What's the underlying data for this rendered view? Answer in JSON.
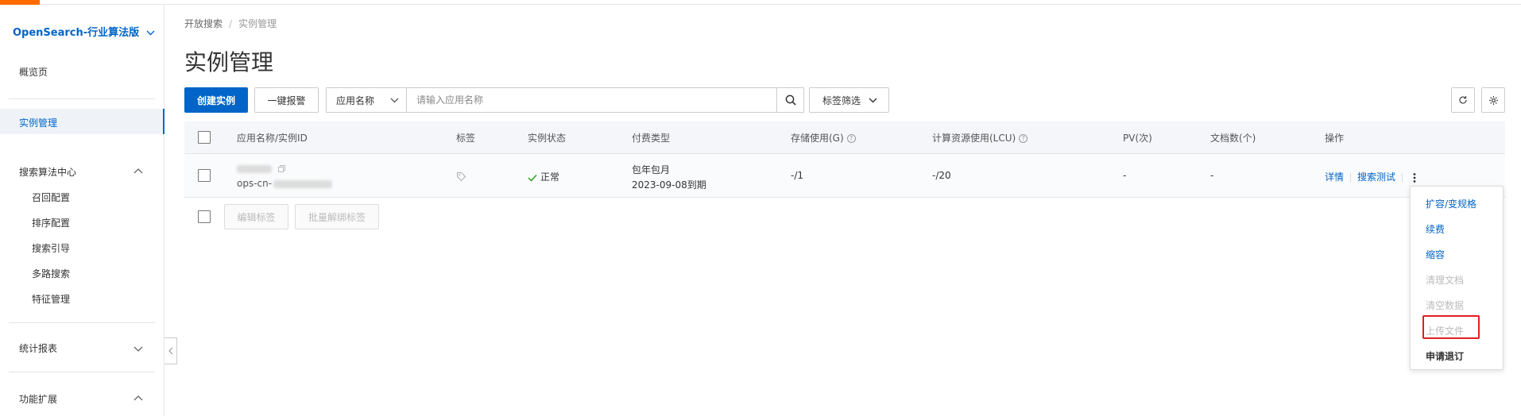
{
  "sidebar": {
    "product": "OpenSearch-行业算法版",
    "overview": "概览页",
    "instances": "实例管理",
    "search_center": "搜索算法中心",
    "search_center_items": [
      "召回配置",
      "排序配置",
      "搜索引导",
      "多路搜索",
      "特征管理"
    ],
    "stats": "统计报表",
    "extensions": "功能扩展"
  },
  "breadcrumb": {
    "root": "开放搜索",
    "current": "实例管理"
  },
  "page_title": "实例管理",
  "toolbar": {
    "create": "创建实例",
    "alarm": "一键报警",
    "search_field": "应用名称",
    "search_placeholder": "请输入应用名称",
    "tag_filter": "标签筛选"
  },
  "table": {
    "columns": [
      "应用名称/实例ID",
      "标签",
      "实例状态",
      "付费类型",
      "存储使用(G)",
      "计算资源使用(LCU)",
      "PV(次)",
      "文档数(个)",
      "操作"
    ],
    "rows": [
      {
        "instance_id_prefix": "ops-cn-",
        "status": "正常",
        "billing": "包年包月",
        "expire": "2023-09-08到期",
        "storage": "-/1",
        "compute": "-/20",
        "pv": "-",
        "docs": "-",
        "action_detail": "详情",
        "action_test": "搜索测试"
      }
    ],
    "bulk_edit_tags": "编辑标签",
    "bulk_unbind_tags": "批量解绑标签"
  },
  "dropdown": {
    "items": [
      {
        "label": "扩容/变规格",
        "state": "enabled"
      },
      {
        "label": "续费",
        "state": "enabled"
      },
      {
        "label": "缩容",
        "state": "enabled"
      },
      {
        "label": "清理文档",
        "state": "disabled"
      },
      {
        "label": "清空数据",
        "state": "disabled"
      },
      {
        "label": "上传文件",
        "state": "disabled"
      },
      {
        "label": "申请退订",
        "state": "strong"
      }
    ]
  },
  "colors": {
    "accent": "#ff6a00",
    "primary": "#0064c8",
    "success": "#2ea121",
    "highlight": "#e02020"
  }
}
